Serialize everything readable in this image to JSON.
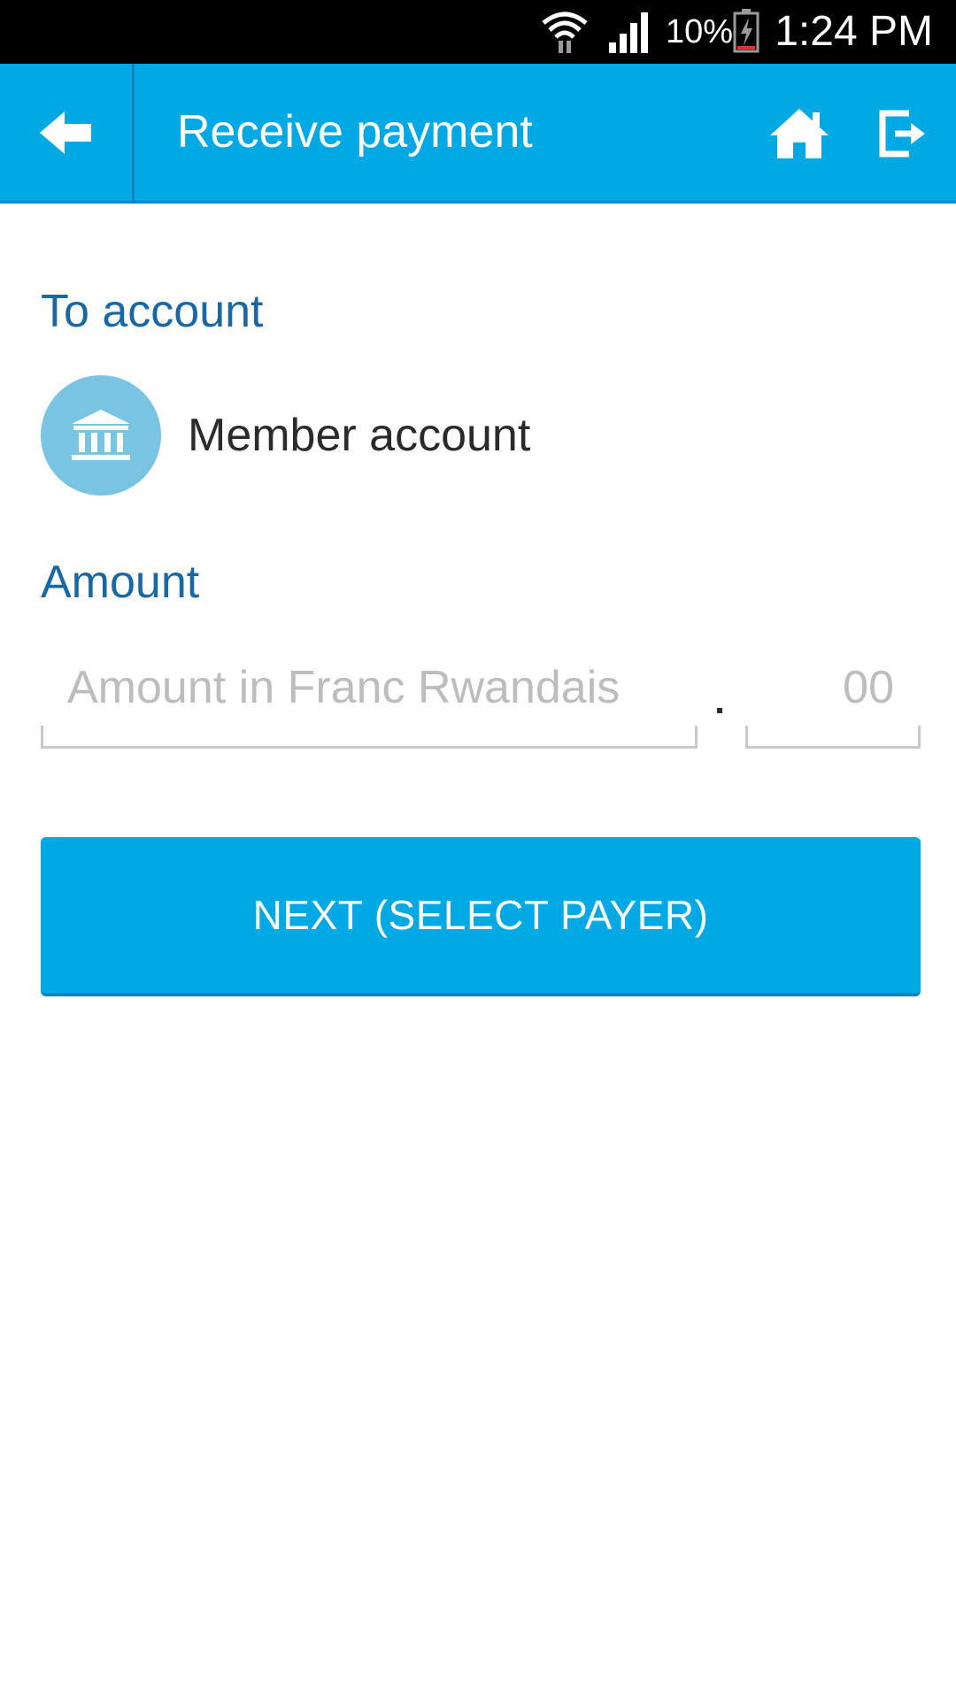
{
  "status_bar": {
    "battery_percent": "10%",
    "time": "1:24 PM",
    "icons": [
      "wifi-icon",
      "signal-icon",
      "battery-charging-icon"
    ]
  },
  "app_bar": {
    "title": "Receive payment",
    "back_icon": "back-arrow-icon",
    "home_icon": "home-icon",
    "logout_icon": "logout-icon",
    "background_color": "#00a8e4"
  },
  "to_account": {
    "label": "To account",
    "account_name": "Member account",
    "icon": "bank-icon"
  },
  "amount": {
    "label": "Amount",
    "placeholder": "Amount in Franc Rwandais",
    "value": "",
    "decimals_placeholder": "00",
    "decimals_value": "",
    "separator": "."
  },
  "next_button": {
    "label": "NEXT (SELECT PAYER)"
  },
  "colors": {
    "accent": "#00a8e4",
    "label_blue": "#1a67a6",
    "icon_circle": "#79c3e3"
  }
}
